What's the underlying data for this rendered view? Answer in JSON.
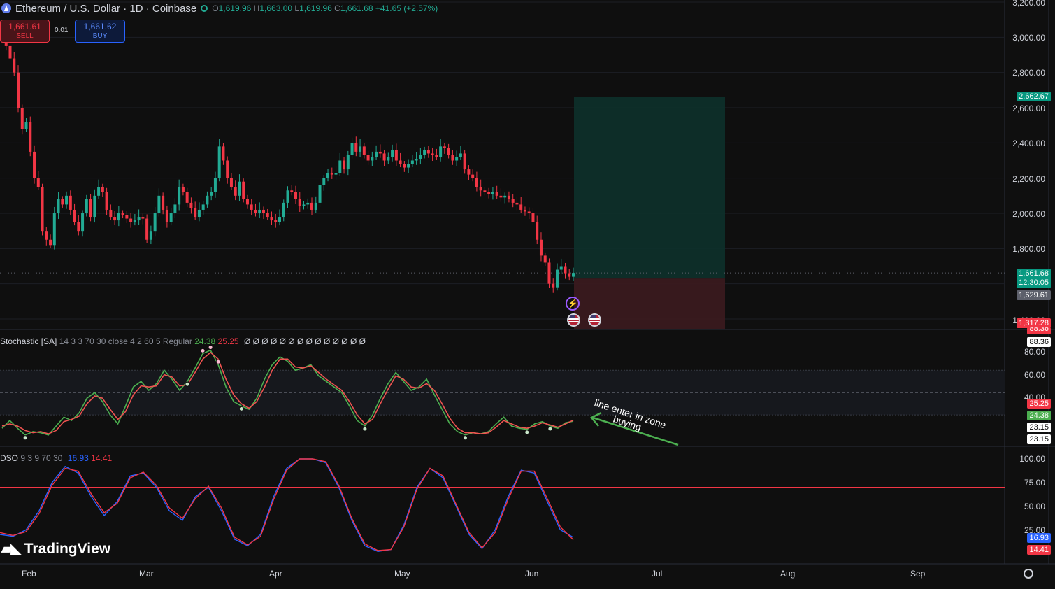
{
  "header": {
    "symbol": "Ethereum / U.S. Dollar · 1D · Coinbase",
    "o_label": "O",
    "o": "1,619.96",
    "h_label": "H",
    "h": "1,663.00",
    "l_label": "L",
    "l": "1,619.96",
    "c_label": "C",
    "c": "1,661.68",
    "change": "+41.65 (+2.57%)"
  },
  "trade": {
    "sell_price": "1,661.61",
    "sell_label": "SELL",
    "spread": "0.01",
    "buy_price": "1,661.62",
    "buy_label": "BUY"
  },
  "price_axis": {
    "ticks": [
      "3,200.00",
      "3,000.00",
      "2,800.00",
      "2,600.00",
      "2,400.00",
      "2,200.00",
      "2,000.00",
      "1,800.00",
      "1,400.00"
    ]
  },
  "price_labels": {
    "target": "2,662.67",
    "last": "1,661.68",
    "countdown": "12:30:05",
    "entry": "1,629.61",
    "stop": "1,317.28"
  },
  "stoch": {
    "title": "Stochastic [SA]",
    "params": "14 3 3 70 30 close 4 2 60 5 Regular",
    "k": "24.38",
    "d": "25.25",
    "markers": "Ø Ø Ø Ø Ø Ø Ø Ø Ø Ø Ø Ø Ø Ø",
    "axis": [
      "80.00",
      "60.00",
      "40.00"
    ],
    "labels": {
      "top_hidden": "88.36",
      "top": "88.36",
      "d": "25.25",
      "k": "24.38",
      "a": "23.15",
      "b": "23.15"
    }
  },
  "dso": {
    "title": "DSO",
    "params": "9 3 9 70 30",
    "blue": "16.93",
    "red": "14.41",
    "axis": [
      "100.00",
      "75.00",
      "50.00",
      "25.00"
    ]
  },
  "annotation": {
    "line1": "line enter in zone",
    "line2": "buying"
  },
  "x_axis": [
    "Feb",
    "Mar",
    "Apr",
    "May",
    "Jun",
    "Jul",
    "Aug",
    "Sep"
  ],
  "logo": "TradingView",
  "chart_data": [
    {
      "type": "candlestick",
      "title": "Ethereum / U.S. Dollar · 1D · Coinbase",
      "y_range": [
        1400,
        3200
      ],
      "closes": [
        3000,
        2950,
        2880,
        2800,
        2600,
        2480,
        2520,
        2350,
        2200,
        2150,
        1900,
        1850,
        1820,
        2000,
        2080,
        2050,
        2100,
        2020,
        1950,
        1900,
        2000,
        2080,
        1980,
        2100,
        2150,
        2120,
        2020,
        1980,
        1960,
        2000,
        1990,
        1970,
        1950,
        1960,
        1980,
        1970,
        1850,
        1900,
        2000,
        2100,
        2020,
        1950,
        2000,
        2050,
        2150,
        2120,
        2060,
        2030,
        1980,
        2020,
        2050,
        2100,
        2120,
        2200,
        2380,
        2300,
        2200,
        2150,
        2100,
        2180,
        2080,
        2050,
        2020,
        2000,
        2020,
        2000,
        1980,
        1960,
        1950,
        1980,
        2060,
        2130,
        2120,
        2080,
        2040,
        2050,
        2060,
        2020,
        2060,
        2160,
        2200,
        2230,
        2220,
        2230,
        2300,
        2250,
        2330,
        2400,
        2350,
        2380,
        2330,
        2300,
        2320,
        2350,
        2340,
        2300,
        2320,
        2360,
        2300,
        2280,
        2260,
        2280,
        2300,
        2310,
        2330,
        2360,
        2340,
        2330,
        2320,
        2380,
        2370,
        2330,
        2300,
        2320,
        2340,
        2250,
        2220,
        2200,
        2150,
        2130,
        2120,
        2110,
        2120,
        2100,
        2090,
        2100,
        2080,
        2060,
        2050,
        2020,
        2010,
        2000,
        1950,
        1850,
        1760,
        1720,
        1600,
        1580,
        1680,
        1700,
        1660,
        1640,
        1661.68
      ],
      "stop_loss": 1317.28,
      "entry": 1629.61,
      "take_profit": 2662.67
    },
    {
      "type": "line",
      "title": "Stochastic [SA]",
      "y_range": [
        0,
        100
      ],
      "levels": [
        70,
        30
      ],
      "series": [
        {
          "name": "%K",
          "color": "#4caf50",
          "values": [
            18,
            25,
            18,
            12,
            15,
            14,
            12,
            20,
            28,
            25,
            32,
            45,
            50,
            42,
            30,
            22,
            38,
            55,
            60,
            52,
            58,
            70,
            62,
            52,
            60,
            72,
            85,
            88,
            75,
            55,
            42,
            38,
            35,
            45,
            62,
            75,
            82,
            78,
            70,
            72,
            75,
            65,
            60,
            55,
            50,
            38,
            25,
            20,
            30,
            45,
            58,
            68,
            60,
            52,
            55,
            62,
            48,
            35,
            22,
            15,
            12,
            14,
            13,
            15,
            22,
            28,
            20,
            18,
            17,
            22,
            24,
            20,
            18,
            23,
            24.38
          ]
        },
        {
          "name": "%D",
          "color": "#ef5350",
          "values": [
            20,
            22,
            20,
            16,
            14,
            15,
            13,
            16,
            24,
            26,
            29,
            40,
            47,
            45,
            35,
            26,
            33,
            48,
            56,
            55,
            56,
            66,
            64,
            56,
            57,
            68,
            80,
            86,
            80,
            62,
            48,
            40,
            36,
            42,
            55,
            70,
            80,
            80,
            73,
            72,
            74,
            68,
            62,
            57,
            52,
            42,
            30,
            22,
            26,
            40,
            53,
            65,
            62,
            55,
            54,
            58,
            52,
            40,
            27,
            18,
            14,
            14,
            13,
            14,
            19,
            25,
            22,
            19,
            18,
            20,
            23,
            21,
            19,
            22,
            25.25
          ]
        }
      ]
    },
    {
      "type": "line",
      "title": "DSO",
      "y_range": [
        0,
        100
      ],
      "levels": [
        70,
        30
      ],
      "series": [
        {
          "name": "blue",
          "color": "#2962ff",
          "values": [
            20,
            18,
            25,
            45,
            75,
            92,
            85,
            60,
            40,
            55,
            82,
            85,
            70,
            45,
            35,
            60,
            70,
            45,
            15,
            8,
            20,
            60,
            90,
            100,
            100,
            96,
            70,
            35,
            8,
            2,
            4,
            30,
            70,
            90,
            80,
            50,
            20,
            5,
            25,
            60,
            88,
            85,
            55,
            25,
            16.93
          ]
        },
        {
          "name": "red",
          "color": "#f23645",
          "values": [
            22,
            19,
            23,
            42,
            72,
            90,
            87,
            63,
            43,
            53,
            80,
            86,
            72,
            48,
            37,
            58,
            71,
            48,
            17,
            9,
            18,
            57,
            88,
            100,
            100,
            97,
            72,
            37,
            10,
            3,
            4,
            28,
            68,
            90,
            82,
            52,
            22,
            6,
            22,
            57,
            87,
            87,
            58,
            28,
            14.41
          ]
        }
      ]
    }
  ]
}
